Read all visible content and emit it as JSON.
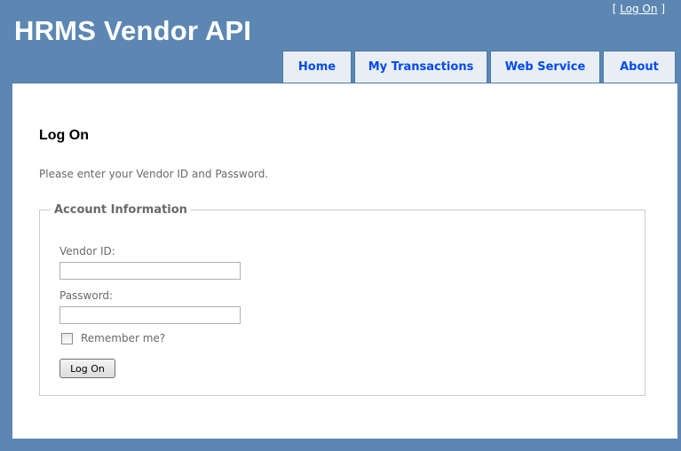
{
  "header": {
    "title": "HRMS Vendor API",
    "login_display": {
      "bracket_open": "[ ",
      "link_label": "Log On",
      "bracket_close": " ]"
    }
  },
  "menu": {
    "items": [
      {
        "label": "Home"
      },
      {
        "label": "My Transactions"
      },
      {
        "label": "Web Service"
      },
      {
        "label": "About"
      }
    ]
  },
  "main": {
    "heading": "Log On",
    "intro": "Please enter your Vendor ID and Password.",
    "fieldset": {
      "legend": "Account Information",
      "vendor_id_label": "Vendor ID:",
      "vendor_id_value": "",
      "password_label": "Password:",
      "password_value": "",
      "remember_label": "Remember me?",
      "remember_checked": false,
      "submit_label": "Log On"
    }
  },
  "colors": {
    "page_background": "#5c87b2",
    "menu_background": "#e8eef4",
    "menu_text": "#034af3",
    "body_text": "#696969"
  }
}
